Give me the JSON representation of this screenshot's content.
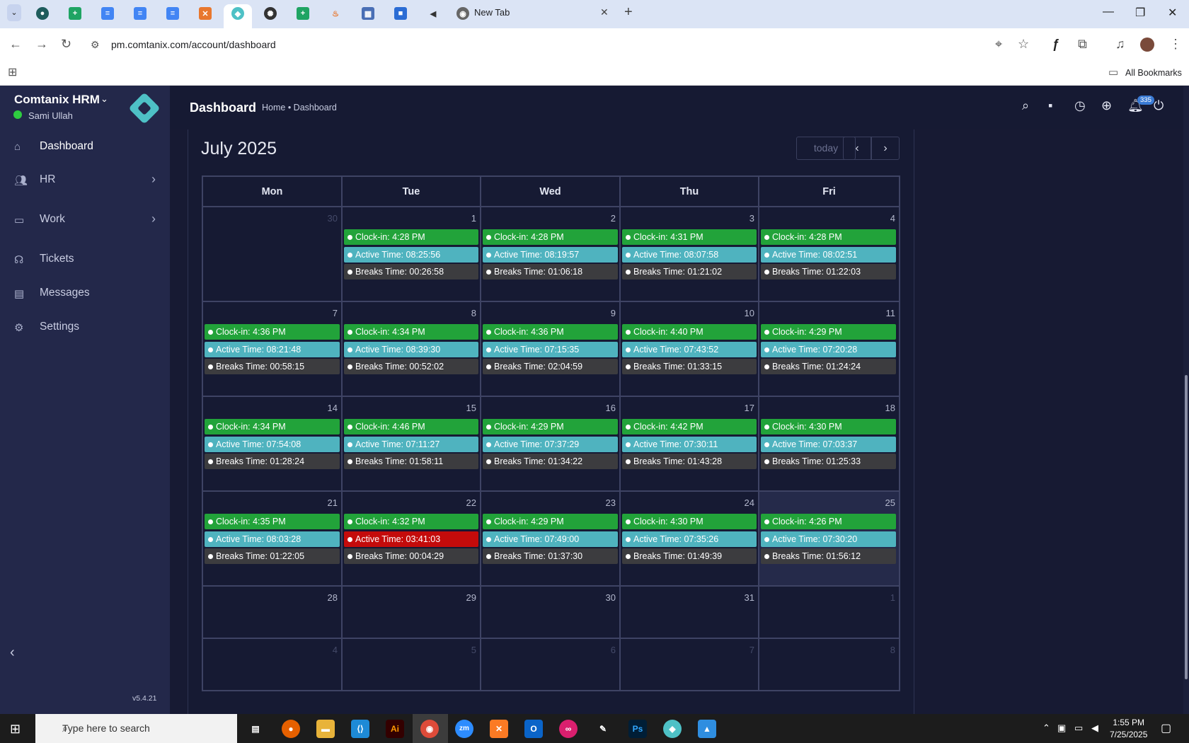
{
  "browser": {
    "new_tab_label": "New Tab",
    "url": "pm.comtanix.com/account/dashboard",
    "bookmarks_label": "All Bookmarks"
  },
  "sidebar": {
    "brand": "Comtanix HRM",
    "user": "Sami Ullah",
    "items": [
      {
        "label": "Dashboard",
        "icon": "home-icon"
      },
      {
        "label": "HR",
        "icon": "users-icon"
      },
      {
        "label": "Work",
        "icon": "briefcase-icon"
      },
      {
        "label": "Tickets",
        "icon": "headset-icon"
      },
      {
        "label": "Messages",
        "icon": "message-icon"
      },
      {
        "label": "Settings",
        "icon": "gear-icon"
      }
    ],
    "version": "v5.4.21"
  },
  "header": {
    "title": "Dashboard",
    "breadcrumb": "Home • Dashboard",
    "notification_count": "335"
  },
  "calendar": {
    "title": "July 2025",
    "today_label": "today",
    "days": [
      "Mon",
      "Tue",
      "Wed",
      "Thu",
      "Fri"
    ],
    "weeks": [
      [
        {
          "d": "30",
          "o": true
        },
        {
          "d": "1",
          "c": "Clock-in: 4:28 PM",
          "a": "Active Time: 08:25:56",
          "b": "Breaks Time: 00:26:58"
        },
        {
          "d": "2",
          "c": "Clock-in: 4:28 PM",
          "a": "Active Time: 08:19:57",
          "b": "Breaks Time: 01:06:18"
        },
        {
          "d": "3",
          "c": "Clock-in: 4:31 PM",
          "a": "Active Time: 08:07:58",
          "b": "Breaks Time: 01:21:02"
        },
        {
          "d": "4",
          "c": "Clock-in: 4:28 PM",
          "a": "Active Time: 08:02:51",
          "b": "Breaks Time: 01:22:03"
        }
      ],
      [
        {
          "d": "7",
          "c": "Clock-in: 4:36 PM",
          "a": "Active Time: 08:21:48",
          "b": "Breaks Time: 00:58:15"
        },
        {
          "d": "8",
          "c": "Clock-in: 4:34 PM",
          "a": "Active Time: 08:39:30",
          "b": "Breaks Time: 00:52:02"
        },
        {
          "d": "9",
          "c": "Clock-in: 4:36 PM",
          "a": "Active Time: 07:15:35",
          "b": "Breaks Time: 02:04:59"
        },
        {
          "d": "10",
          "c": "Clock-in: 4:40 PM",
          "a": "Active Time: 07:43:52",
          "b": "Breaks Time: 01:33:15"
        },
        {
          "d": "11",
          "c": "Clock-in: 4:29 PM",
          "a": "Active Time: 07:20:28",
          "b": "Breaks Time: 01:24:24"
        }
      ],
      [
        {
          "d": "14",
          "c": "Clock-in: 4:34 PM",
          "a": "Active Time: 07:54:08",
          "b": "Breaks Time: 01:28:24"
        },
        {
          "d": "15",
          "c": "Clock-in: 4:46 PM",
          "a": "Active Time: 07:11:27",
          "b": "Breaks Time: 01:58:11"
        },
        {
          "d": "16",
          "c": "Clock-in: 4:29 PM",
          "a": "Active Time: 07:37:29",
          "b": "Breaks Time: 01:34:22"
        },
        {
          "d": "17",
          "c": "Clock-in: 4:42 PM",
          "a": "Active Time: 07:30:11",
          "b": "Breaks Time: 01:43:28"
        },
        {
          "d": "18",
          "c": "Clock-in: 4:30 PM",
          "a": "Active Time: 07:03:37",
          "b": "Breaks Time: 01:25:33"
        }
      ],
      [
        {
          "d": "21",
          "c": "Clock-in: 4:35 PM",
          "a": "Active Time: 08:03:28",
          "b": "Breaks Time: 01:22:05"
        },
        {
          "d": "22",
          "c": "Clock-in: 4:32 PM",
          "a": "Active Time: 03:41:03",
          "b": "Breaks Time: 00:04:29",
          "warn": true
        },
        {
          "d": "23",
          "c": "Clock-in: 4:29 PM",
          "a": "Active Time: 07:49:00",
          "b": "Breaks Time: 01:37:30"
        },
        {
          "d": "24",
          "c": "Clock-in: 4:30 PM",
          "a": "Active Time: 07:35:26",
          "b": "Breaks Time: 01:49:39"
        },
        {
          "d": "25",
          "c": "Clock-in: 4:26 PM",
          "a": "Active Time: 07:30:20",
          "b": "Breaks Time: 01:56:12",
          "today": true
        }
      ],
      [
        {
          "d": "28"
        },
        {
          "d": "29"
        },
        {
          "d": "30"
        },
        {
          "d": "31"
        },
        {
          "d": "1",
          "o": true
        }
      ],
      [
        {
          "d": "4",
          "o": true
        },
        {
          "d": "5",
          "o": true
        },
        {
          "d": "6",
          "o": true
        },
        {
          "d": "7",
          "o": true
        },
        {
          "d": "8",
          "o": true
        }
      ]
    ],
    "colors": {
      "clock_in": "#22a33a",
      "active": "#4fb3bf",
      "active_low": "#c40b0b",
      "breaks": "#3c3c3f"
    }
  },
  "taskbar": {
    "search_placeholder": "Type here to search",
    "time": "1:55 PM",
    "date": "7/25/2025"
  }
}
